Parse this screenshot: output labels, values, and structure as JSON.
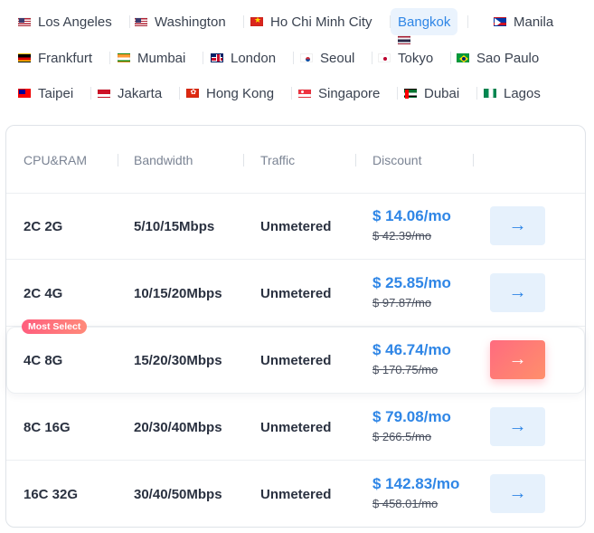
{
  "locations": [
    {
      "name": "Los Angeles",
      "flag": "us-flag-icon",
      "active": false
    },
    {
      "name": "Washington",
      "flag": "us-flag-icon",
      "active": false
    },
    {
      "name": "Ho Chi Minh City",
      "flag": "vietnam-flag-icon",
      "active": false
    },
    {
      "name": "Bangkok",
      "flag": "thailand-flag-icon",
      "active": true
    },
    {
      "name": "Manila",
      "flag": "philippines-flag-icon",
      "active": false
    },
    {
      "name": "Frankfurt",
      "flag": "germany-flag-icon",
      "active": false
    },
    {
      "name": "Mumbai",
      "flag": "india-flag-icon",
      "active": false
    },
    {
      "name": "London",
      "flag": "uk-flag-icon",
      "active": false
    },
    {
      "name": "Seoul",
      "flag": "south-korea-flag-icon",
      "active": false
    },
    {
      "name": "Tokyo",
      "flag": "japan-flag-icon",
      "active": false
    },
    {
      "name": "Sao Paulo",
      "flag": "brazil-flag-icon",
      "active": false
    },
    {
      "name": "Taipei",
      "flag": "taiwan-flag-icon",
      "active": false
    },
    {
      "name": "Jakarta",
      "flag": "indonesia-flag-icon",
      "active": false
    },
    {
      "name": "Hong Kong",
      "flag": "hong-kong-flag-icon",
      "active": false
    },
    {
      "name": "Singapore",
      "flag": "singapore-flag-icon",
      "active": false
    },
    {
      "name": "Dubai",
      "flag": "uae-flag-icon",
      "active": false
    },
    {
      "name": "Lagos",
      "flag": "nigeria-flag-icon",
      "active": false
    }
  ],
  "table": {
    "headers": {
      "cpu_ram": "CPU&RAM",
      "bandwidth": "Bandwidth",
      "traffic": "Traffic",
      "discount": "Discount"
    },
    "badge": "Most Select",
    "plans": [
      {
        "cpu_ram": "2C 2G",
        "bandwidth": "5/10/15Mbps",
        "traffic": "Unmetered",
        "price": "$ 14.06/mo",
        "old_price": "$ 42.39/mo",
        "featured": false
      },
      {
        "cpu_ram": "2C 4G",
        "bandwidth": "10/15/20Mbps",
        "traffic": "Unmetered",
        "price": "$ 25.85/mo",
        "old_price": "$ 97.87/mo",
        "featured": false
      },
      {
        "cpu_ram": "4C 8G",
        "bandwidth": "15/20/30Mbps",
        "traffic": "Unmetered",
        "price": "$ 46.74/mo",
        "old_price": "$ 170.75/mo",
        "featured": true
      },
      {
        "cpu_ram": "8C 16G",
        "bandwidth": "20/30/40Mbps",
        "traffic": "Unmetered",
        "price": "$ 79.08/mo",
        "old_price": "$ 266.5/mo",
        "featured": false
      },
      {
        "cpu_ram": "16C 32G",
        "bandwidth": "30/40/50Mbps",
        "traffic": "Unmetered",
        "price": "$ 142.83/mo",
        "old_price": "$ 458.01/mo",
        "featured": false
      }
    ]
  },
  "colors": {
    "accent": "#2f86e6",
    "hot": "#ff6b7f",
    "active_tab_bg": "#eaf3fd"
  },
  "icons": {
    "order_button": "arrow-right-icon"
  }
}
